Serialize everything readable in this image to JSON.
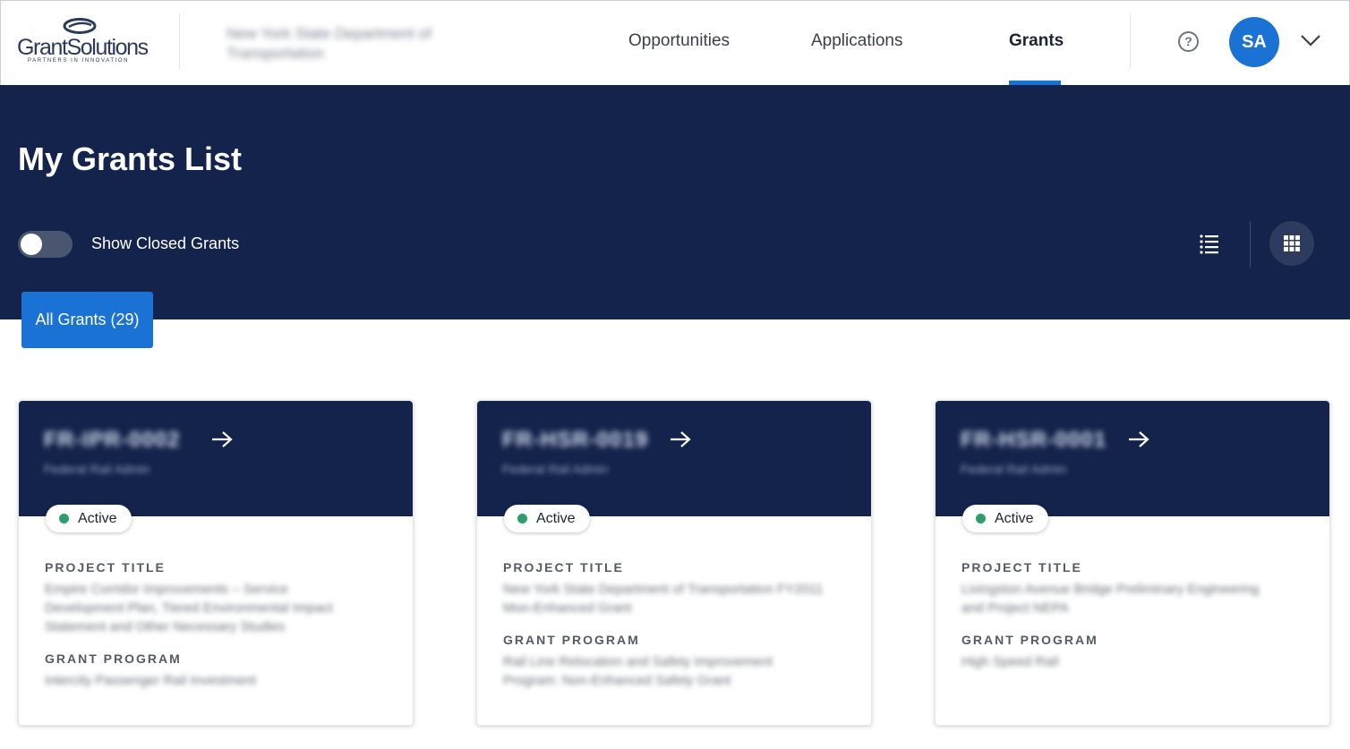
{
  "header": {
    "logo": {
      "wordmark": "GrantSolutions",
      "tagline": "PARTNERS IN INNOVATION"
    },
    "organization": "New York State Department of Transportation",
    "nav": [
      {
        "label": "Opportunities",
        "active": false
      },
      {
        "label": "Applications",
        "active": false
      },
      {
        "label": "Grants",
        "active": true
      }
    ],
    "help_icon": "question-circle-icon",
    "user_initials": "SA",
    "menu_icon": "chevron-down-icon"
  },
  "hero": {
    "title": "My Grants List",
    "toggle": {
      "label": "Show Closed Grants",
      "on": false
    },
    "view_buttons": {
      "list": "list-view-icon",
      "grid": "grid-view-icon",
      "active": "grid"
    },
    "filter_tab": "All Grants (29)"
  },
  "cards": [
    {
      "grant_number": "FR-IPR-0002",
      "subtitle": "Federal Rail Admin",
      "status": "Active",
      "project_title_label": "PROJECT TITLE",
      "project_title": "Empire Corridor Improvements – Service Development Plan, Tiered Environmental Impact Statement and Other Necessary Studies",
      "grant_program_label": "GRANT PROGRAM",
      "grant_program": "Intercity Passenger Rail Investment"
    },
    {
      "grant_number": "FR-HSR-0019",
      "subtitle": "Federal Rail Admin",
      "status": "Active",
      "project_title_label": "PROJECT TITLE",
      "project_title": "New York State Department of Transportation FY2011 Mon-Enhanced Grant",
      "grant_program_label": "GRANT PROGRAM",
      "grant_program": "Rail Line Relocation and Safety Improvement Program: Non-Enhanced Safety Grant"
    },
    {
      "grant_number": "FR-HSR-0001",
      "subtitle": "Federal Rail Admin",
      "status": "Active",
      "project_title_label": "PROJECT TITLE",
      "project_title": "Livingston Avenue Bridge Preliminary Engineering and Project NEPA",
      "grant_program_label": "GRANT PROGRAM",
      "grant_program": "High Speed Rail"
    }
  ],
  "colors": {
    "navy": "#13234b",
    "accent_blue": "#1a73d4",
    "status_green": "#2e9e6a"
  }
}
